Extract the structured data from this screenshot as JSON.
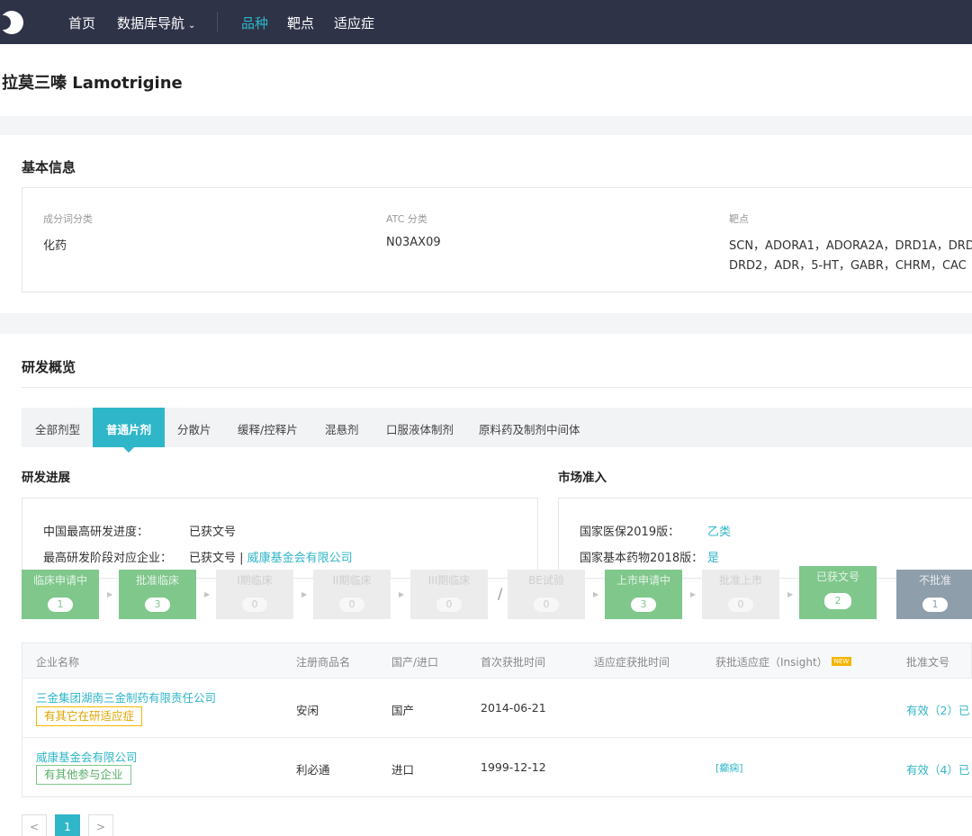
{
  "nav": {
    "items": [
      {
        "label": "首页"
      },
      {
        "label": "数据库导航"
      },
      {
        "label": "品种"
      },
      {
        "label": "靶点"
      },
      {
        "label": "适应症"
      }
    ],
    "dropdown_icon": "chevron-down-icon"
  },
  "page": {
    "title": "拉莫三嗪 Lamotrigine"
  },
  "basic_info": {
    "title": "基本信息",
    "fields": [
      {
        "label": "成分词分类",
        "value": "化药"
      },
      {
        "label": "ATC 分类",
        "value": "N03AX09"
      },
      {
        "label": "靶点",
        "value_line1": "SCN，ADORA1，ADORA2A，DRD1A，DRD",
        "value_line2": "DRD2，ADR，5-HT，GABR，CHRM，CAC"
      }
    ]
  },
  "overview": {
    "title": "研发概览",
    "tabs": [
      "全部剂型",
      "普通片剂",
      "分散片",
      "缓释/控释片",
      "混悬剂",
      "口服液体制剂",
      "原料药及制剂中间体"
    ],
    "active_tab": "普通片剂",
    "progress": {
      "title": "研发进展",
      "rows": [
        {
          "label": "中国最高研发进度：",
          "value": "已获文号",
          "company": ""
        },
        {
          "label": "最高研发阶段对应企业：",
          "value": "已获文号 |",
          "company": "威康基金会有限公司"
        }
      ]
    },
    "market": {
      "title": "市场准入",
      "rows": [
        {
          "label": "国家医保2019版：",
          "value": "乙类"
        },
        {
          "label": "国家基本药物2018版：",
          "value": "是"
        }
      ]
    },
    "stages": [
      {
        "label": "临床申请中",
        "count": "1",
        "state": "green"
      },
      {
        "label": "批准临床",
        "count": "3",
        "state": "green"
      },
      {
        "label": "I期临床",
        "count": "0",
        "state": "gray"
      },
      {
        "label": "II期临床",
        "count": "0",
        "state": "gray"
      },
      {
        "label": "III期临床",
        "count": "0",
        "state": "gray"
      },
      {
        "label": "BE试验",
        "count": "0",
        "state": "gray"
      },
      {
        "label": "上市申请中",
        "count": "3",
        "state": "green"
      },
      {
        "label": "批准上市",
        "count": "0",
        "state": "gray"
      },
      {
        "label": "已获文号",
        "count": "2",
        "state": "green"
      },
      {
        "label": "不批准",
        "count": "1",
        "state": "slate"
      }
    ],
    "stage_divider": "/",
    "table": {
      "headers": [
        "企业名称",
        "注册商品名",
        "国产/进口",
        "首次获批时间",
        "适应症获批时间",
        "获批适应症（Insight）",
        "批准文号"
      ],
      "new_badge": "NEW",
      "rows": [
        {
          "company": "三金集团湖南三金制药有限责任公司",
          "tag": "有其它在研适应症",
          "brand": "安闲",
          "origin": "国产",
          "first_date": "2014-06-21",
          "ind_date": "",
          "indication": "",
          "approval": "有效（2）已"
        },
        {
          "company": "威康基金会有限公司",
          "tag": "有其他参与企业",
          "brand": "利必通",
          "origin": "进口",
          "first_date": "1999-12-12",
          "ind_date": "",
          "indication": "[癫痫]",
          "approval": "有效（4）已"
        }
      ]
    },
    "pagination": {
      "prev": "<",
      "current": "1",
      "next": ">"
    }
  },
  "colors": {
    "nav_bg": "#2e3348",
    "accent": "#30b6c9",
    "stage_green": "#7fc78b",
    "stage_slate": "#8f9eab",
    "tag_orange": "#f5b800"
  }
}
